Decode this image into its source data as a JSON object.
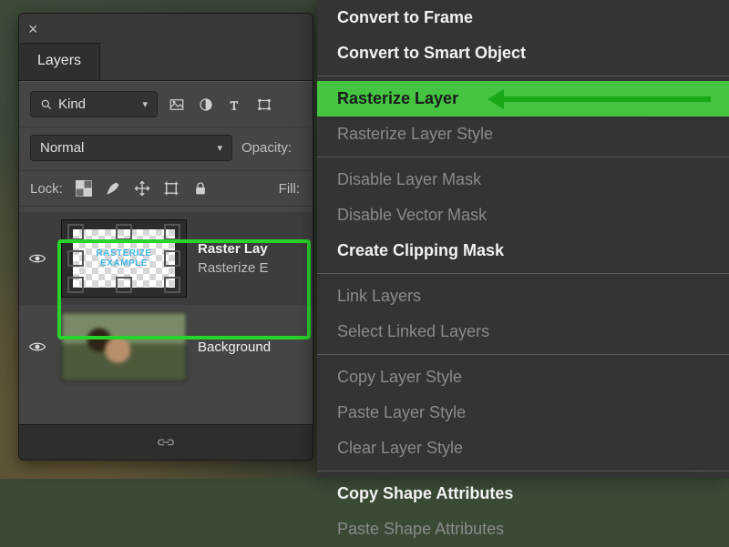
{
  "panel": {
    "title": "Layers",
    "filter": {
      "kind_label": "Kind"
    },
    "blend": {
      "mode": "Normal",
      "opacity_label": "Opacity:"
    },
    "lock": {
      "label": "Lock:",
      "fill_label": "Fill:"
    },
    "layers": [
      {
        "name": "Raster Lay",
        "subtitle": "Rasterize  E",
        "thumb_text": "RASTERIZE\nEXAMPLE",
        "selected": true,
        "visible": true
      },
      {
        "name": "Background",
        "subtitle": "",
        "visible": true
      }
    ]
  },
  "menu": {
    "items": [
      {
        "label": "Convert to Frame",
        "enabled": true,
        "bold": true
      },
      {
        "label": "Convert to Smart Object",
        "enabled": true,
        "bold": true
      },
      {
        "sep": true
      },
      {
        "label": "Rasterize Layer",
        "enabled": true,
        "bold": true,
        "highlight": true
      },
      {
        "label": "Rasterize Layer Style",
        "enabled": false
      },
      {
        "sep": true
      },
      {
        "label": "Disable Layer Mask",
        "enabled": false
      },
      {
        "label": "Disable Vector Mask",
        "enabled": false
      },
      {
        "label": "Create Clipping Mask",
        "enabled": true,
        "bold": true
      },
      {
        "sep": true
      },
      {
        "label": "Link Layers",
        "enabled": false
      },
      {
        "label": "Select Linked Layers",
        "enabled": false
      },
      {
        "sep": true
      },
      {
        "label": "Copy Layer Style",
        "enabled": false
      },
      {
        "label": "Paste Layer Style",
        "enabled": false
      },
      {
        "label": "Clear Layer Style",
        "enabled": false
      },
      {
        "sep": true
      },
      {
        "label": "Copy Shape Attributes",
        "enabled": true,
        "bold": true
      },
      {
        "label": "Paste Shape Attributes",
        "enabled": false
      }
    ]
  }
}
